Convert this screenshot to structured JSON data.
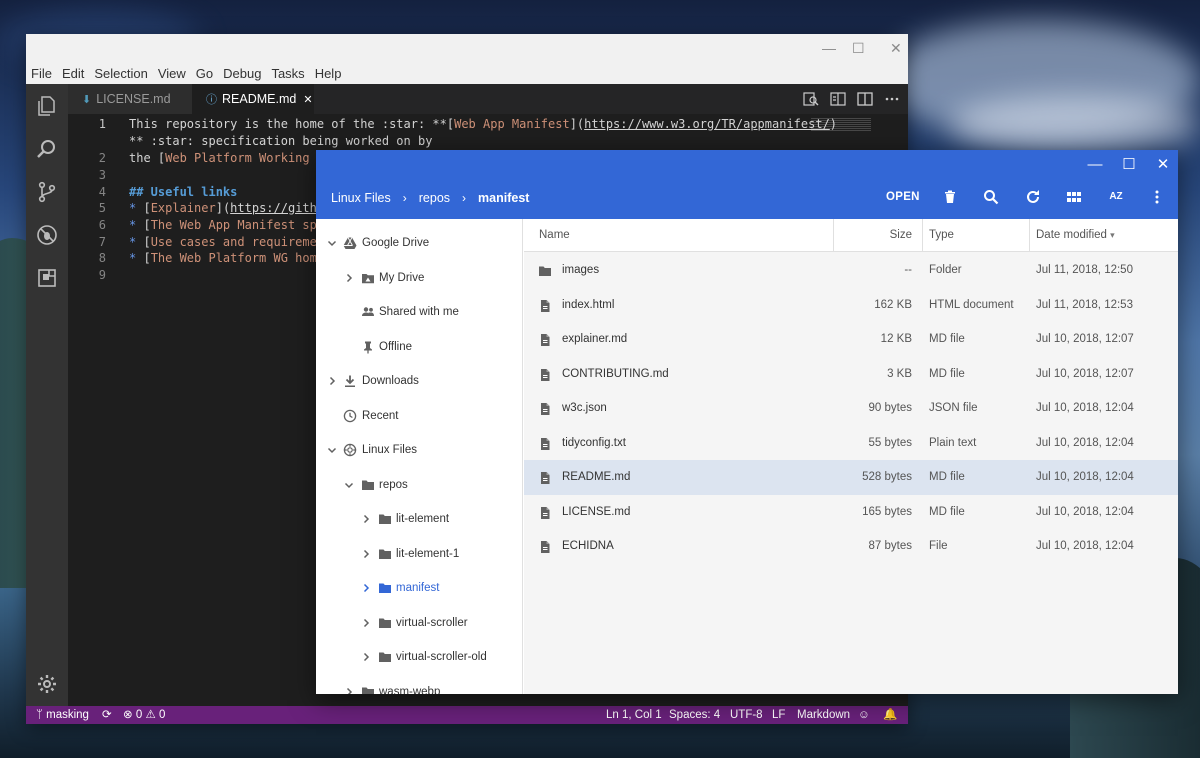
{
  "vscode": {
    "menu": [
      "File",
      "Edit",
      "Selection",
      "View",
      "Go",
      "Debug",
      "Tasks",
      "Help"
    ],
    "window_controls": {
      "minimize": "—",
      "maximize": "☐",
      "close": "✕"
    },
    "tabs": [
      {
        "label": "LICENSE.md",
        "icon": "markdown-icon",
        "active": false
      },
      {
        "label": "README.md",
        "icon": "info-icon",
        "active": true,
        "close": "✕"
      }
    ],
    "editor_lines": [
      {
        "num": "1",
        "segments": [
          {
            "t": "This repository is the home of the :star: **[",
            "c": "plain"
          },
          {
            "t": "Web App Manifest",
            "c": "link"
          },
          {
            "t": "](",
            "c": "plain"
          },
          {
            "t": "https://www.w3.org/TR/appmanifest/",
            "c": "url"
          },
          {
            "t": ")",
            "c": "plain"
          }
        ]
      },
      {
        "num": "",
        "segments": [
          {
            "t": "** :star: specification being worked on by",
            "c": "plain"
          }
        ]
      },
      {
        "num": "2",
        "segments": [
          {
            "t": "the [",
            "c": "plain"
          },
          {
            "t": "Web Platform Working G",
            "c": "link"
          }
        ]
      },
      {
        "num": "3",
        "segments": []
      },
      {
        "num": "4",
        "segments": [
          {
            "t": "## Useful links",
            "c": "head"
          }
        ]
      },
      {
        "num": "5",
        "segments": [
          {
            "t": "* ",
            "c": "bullet"
          },
          {
            "t": "[",
            "c": "plain"
          },
          {
            "t": "Explainer",
            "c": "link"
          },
          {
            "t": "](",
            "c": "plain"
          },
          {
            "t": "https://githul",
            "c": "url"
          }
        ]
      },
      {
        "num": "6",
        "segments": [
          {
            "t": "* ",
            "c": "bullet"
          },
          {
            "t": "[",
            "c": "plain"
          },
          {
            "t": "The Web App Manifest spe",
            "c": "link"
          }
        ]
      },
      {
        "num": "7",
        "segments": [
          {
            "t": "* ",
            "c": "bullet"
          },
          {
            "t": "[",
            "c": "plain"
          },
          {
            "t": "Use cases and requirement",
            "c": "link"
          }
        ]
      },
      {
        "num": "8",
        "segments": [
          {
            "t": "* ",
            "c": "bullet"
          },
          {
            "t": "[",
            "c": "plain"
          },
          {
            "t": "The Web Platform WG homep",
            "c": "link"
          }
        ]
      },
      {
        "num": "9",
        "segments": []
      }
    ],
    "statusbar": {
      "branch": "masking",
      "errors": "0",
      "warnings": "0",
      "position": "Ln 1, Col 1",
      "spaces": "Spaces: 4",
      "encoding": "UTF-8",
      "eol": "LF",
      "language": "Markdown"
    },
    "colors": {
      "statusbar": "#68217a",
      "editor_bg": "#1e1e1e",
      "activity_bg": "#333333"
    }
  },
  "files": {
    "window_controls": {
      "minimize": "—",
      "maximize": "☐",
      "close": "✕"
    },
    "breadcrumb": [
      "Linux Files",
      "repos",
      "manifest"
    ],
    "breadcrumb_sep": "›",
    "open_label": "OPEN",
    "toolbar_icons": [
      "delete-icon",
      "search-icon",
      "refresh-icon",
      "grid-view-icon",
      "sort-az-icon",
      "more-vert-icon"
    ],
    "sort_label": "AZ",
    "nav": [
      {
        "label": "Google Drive",
        "icon": "google-drive-icon",
        "chevron": "down",
        "indent": 0
      },
      {
        "label": "My Drive",
        "icon": "my-drive-icon",
        "chevron": "right",
        "indent": 1
      },
      {
        "label": "Shared with me",
        "icon": "shared-icon",
        "chevron": "none",
        "indent": 1
      },
      {
        "label": "Offline",
        "icon": "pin-icon",
        "chevron": "none",
        "indent": 1
      },
      {
        "label": "Downloads",
        "icon": "download-icon",
        "chevron": "right",
        "indent": 0
      },
      {
        "label": "Recent",
        "icon": "clock-icon",
        "chevron": "none",
        "indent": 0
      },
      {
        "label": "Linux Files",
        "icon": "linux-icon",
        "chevron": "down",
        "indent": 0
      },
      {
        "label": "repos",
        "icon": "folder-icon",
        "chevron": "down",
        "indent": 1
      },
      {
        "label": "lit-element",
        "icon": "folder-icon",
        "chevron": "right",
        "indent": 2
      },
      {
        "label": "lit-element-1",
        "icon": "folder-icon",
        "chevron": "right",
        "indent": 2
      },
      {
        "label": "manifest",
        "icon": "folder-icon",
        "chevron": "right",
        "indent": 2,
        "selected": true
      },
      {
        "label": "virtual-scroller",
        "icon": "folder-icon",
        "chevron": "right",
        "indent": 2
      },
      {
        "label": "virtual-scroller-old",
        "icon": "folder-icon",
        "chevron": "right",
        "indent": 2
      },
      {
        "label": "wasm-webp",
        "icon": "folder-icon",
        "chevron": "right",
        "indent": 1
      }
    ],
    "columns": {
      "name": "Name",
      "size": "Size",
      "type": "Type",
      "date": "Date modified",
      "sort_arrow": "▾"
    },
    "rows": [
      {
        "name": "images",
        "size": "--",
        "type": "Folder",
        "date": "Jul 11, 2018, 12:50",
        "icon": "folder-icon"
      },
      {
        "name": "index.html",
        "size": "162 KB",
        "type": "HTML document",
        "date": "Jul 11, 2018, 12:53",
        "icon": "file-icon"
      },
      {
        "name": "explainer.md",
        "size": "12 KB",
        "type": "MD file",
        "date": "Jul 10, 2018, 12:07",
        "icon": "file-icon"
      },
      {
        "name": "CONTRIBUTING.md",
        "size": "3 KB",
        "type": "MD file",
        "date": "Jul 10, 2018, 12:07",
        "icon": "file-icon"
      },
      {
        "name": "w3c.json",
        "size": "90 bytes",
        "type": "JSON file",
        "date": "Jul 10, 2018, 12:04",
        "icon": "file-icon"
      },
      {
        "name": "tidyconfig.txt",
        "size": "55 bytes",
        "type": "Plain text",
        "date": "Jul 10, 2018, 12:04",
        "icon": "file-icon"
      },
      {
        "name": "README.md",
        "size": "528 bytes",
        "type": "MD file",
        "date": "Jul 10, 2018, 12:04",
        "icon": "file-icon",
        "selected": true
      },
      {
        "name": "LICENSE.md",
        "size": "165 bytes",
        "type": "MD file",
        "date": "Jul 10, 2018, 12:04",
        "icon": "file-icon"
      },
      {
        "name": "ECHIDNA",
        "size": "87 bytes",
        "type": "File",
        "date": "Jul 10, 2018, 12:04",
        "icon": "file-icon"
      }
    ],
    "colors": {
      "header": "#3367d6",
      "selected_row": "#dce4f0",
      "list_bg": "#f5f5f5",
      "selected_nav_text": "#3367d6"
    }
  }
}
